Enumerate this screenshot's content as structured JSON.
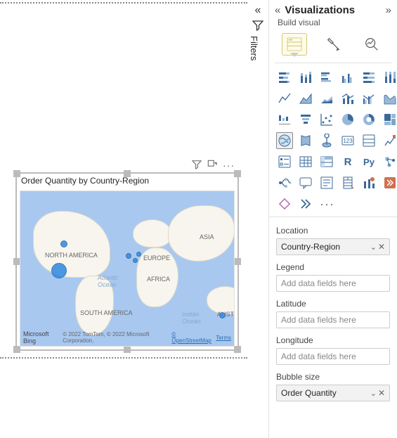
{
  "pane": {
    "title": "Visualizations",
    "subheader": "Build visual",
    "collapse_glyph": "«",
    "expand_glyph": "»"
  },
  "filters": {
    "label": "Filters",
    "collapse_glyph": "«"
  },
  "visual": {
    "title": "Order Quantity by Country-Region",
    "ocean_labels": {
      "atlantic": "Atlantic\nOcean",
      "indian": "Indian\nOcean"
    },
    "continent_labels": {
      "na": "NORTH AMERICA",
      "sa": "SOUTH AMERICA",
      "eu": "EUROPE",
      "af": "AFRICA",
      "as": "ASIA",
      "au": "AUSTR"
    },
    "attribution": {
      "bing": "Microsoft Bing",
      "copyright": "© 2022 TomTom, © 2022 Microsoft Corporation,",
      "osm": "© OpenStreetMap",
      "terms": "Terms"
    }
  },
  "build_tabs": {
    "visual": "build-visual",
    "format": "format-visual",
    "analytics": "analytics"
  },
  "viz_types": [
    "stacked-bar",
    "stacked-column",
    "clustered-bar",
    "clustered-column",
    "100-stacked-bar",
    "100-stacked-column",
    "line",
    "area",
    "stacked-area",
    "line-stacked-column",
    "line-clustered-column",
    "ribbon",
    "waterfall",
    "funnel",
    "scatter",
    "pie",
    "donut",
    "treemap",
    "map",
    "filled-map",
    "arcgis",
    "card",
    "multi-row-card",
    "kpi",
    "slicer",
    "table",
    "matrix",
    "r-visual",
    "python-visual",
    "key-influencers",
    "decomposition-tree",
    "qna",
    "smart-narrative",
    "paginated-report",
    "power-apps",
    "power-automate",
    "apps",
    "more-arrow"
  ],
  "selected_viz": "map",
  "field_wells": {
    "location": {
      "label": "Location",
      "value": "Country-Region",
      "filled": true
    },
    "legend": {
      "label": "Legend",
      "placeholder": "Add data fields here",
      "filled": false
    },
    "latitude": {
      "label": "Latitude",
      "placeholder": "Add data fields here",
      "filled": false
    },
    "longitude": {
      "label": "Longitude",
      "placeholder": "Add data fields here",
      "filled": false
    },
    "bubble_size": {
      "label": "Bubble size",
      "value": "Order Quantity",
      "filled": true
    }
  }
}
